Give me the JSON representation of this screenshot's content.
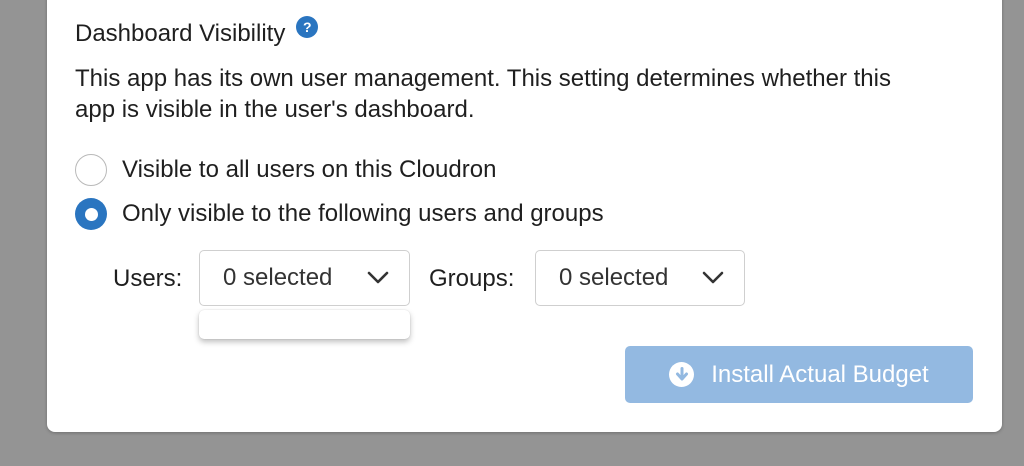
{
  "section": {
    "title": "Dashboard Visibility",
    "help_glyph": "?",
    "description": "This app has its own user management. This setting determines whether this app is visible in the user's dashboard."
  },
  "visibility_options": [
    {
      "label": "Visible to all users on this Cloudron",
      "selected": false
    },
    {
      "label": "Only visible to the following users and groups",
      "selected": true
    }
  ],
  "users": {
    "label": "Users:",
    "value": "0 selected",
    "menu_open": true
  },
  "groups": {
    "label": "Groups:",
    "value": "0 selected",
    "menu_open": false
  },
  "install_button": {
    "label": "Install Actual Budget",
    "icon": "download-icon",
    "disabled": true
  },
  "colors": {
    "accent": "#2a75c0",
    "button_disabled": "#93b9e1",
    "overlay": "#949494"
  }
}
